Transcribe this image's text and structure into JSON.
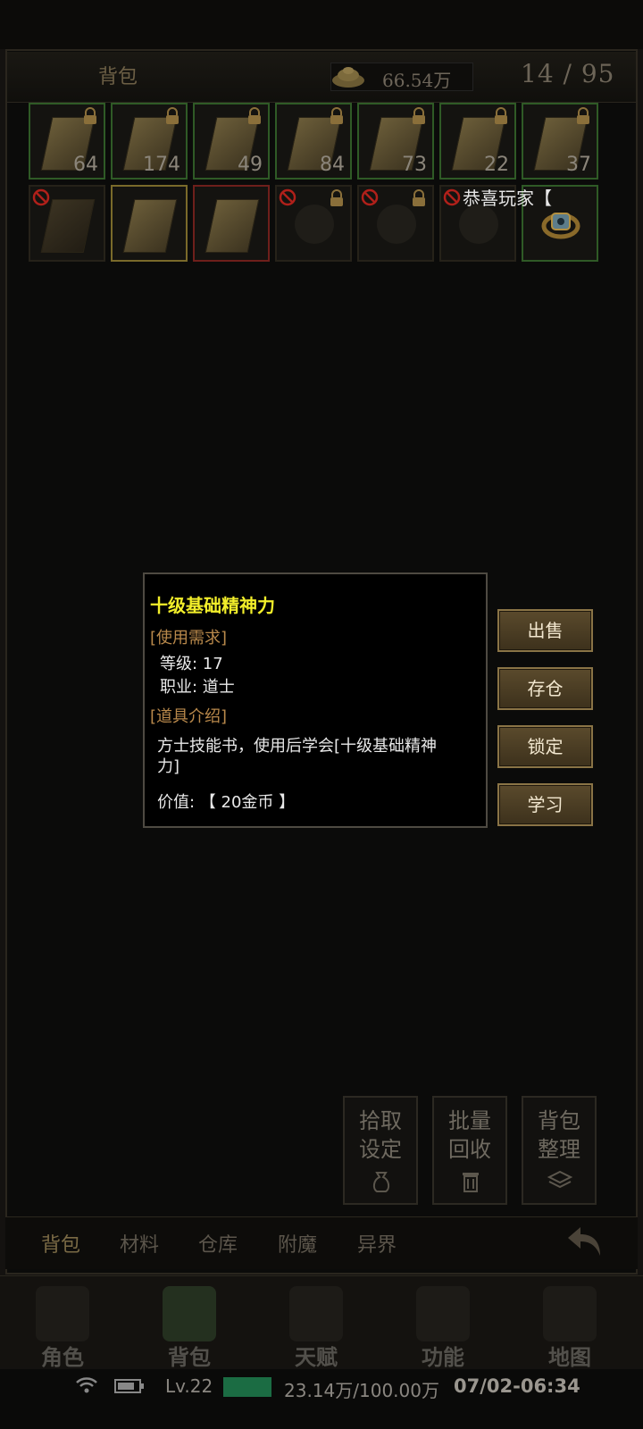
{
  "header": {
    "title": "背包",
    "gold": "66.54万",
    "capacity": "14 / 95"
  },
  "inventory": {
    "row1": [
      {
        "count": "64",
        "locked": true
      },
      {
        "count": "174",
        "locked": true
      },
      {
        "count": "49",
        "locked": true
      },
      {
        "count": "84",
        "locked": true
      },
      {
        "count": "73",
        "locked": true
      },
      {
        "count": "22",
        "locked": true
      },
      {
        "count": "37",
        "locked": true
      }
    ],
    "row2_count": 7
  },
  "toast": "恭喜玩家【",
  "tooltip": {
    "name": "十级基础精神力",
    "req_header": "[使用需求]",
    "level": "等级: 17",
    "job": "职业: 道士",
    "intro_header": "[道具介绍]",
    "intro_1": "方士技能书，使用后学会[十级基础精神",
    "intro_2": "力]",
    "value": "价值: 【 20金币 】"
  },
  "side_buttons": {
    "sell": "出售",
    "store": "存仓",
    "lock": "锁定",
    "learn": "学习"
  },
  "actions": {
    "pickup": [
      "拾取",
      "设定"
    ],
    "recycle": [
      "批量",
      "回收"
    ],
    "sort": [
      "背包",
      "整理"
    ]
  },
  "tabs": [
    "背包",
    "材料",
    "仓库",
    "附魔",
    "异界"
  ],
  "nav": [
    "角色",
    "背包",
    "天赋",
    "功能",
    "地图"
  ],
  "status": {
    "level": "Lv.22",
    "exp": "23.14万/100.00万",
    "datetime": "07/02-06:34"
  },
  "colors": {
    "accent_gold": "#b9894b",
    "item_name": "#f2ee2a",
    "xp_bar": "#1b6c43"
  }
}
